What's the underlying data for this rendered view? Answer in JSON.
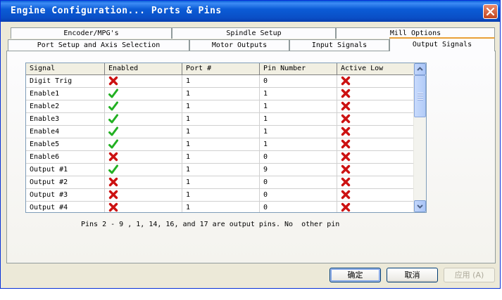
{
  "window": {
    "title": "Engine Configuration... Ports & Pins"
  },
  "tabs_back": [
    "Encoder/MPG's",
    "Spindle Setup",
    "Mill Options"
  ],
  "tabs_front": [
    "Port Setup and Axis Selection",
    "Motor Outputs",
    "Input Signals",
    "Output Signals"
  ],
  "active_tab": "Output Signals",
  "grid": {
    "columns": [
      "Signal",
      "Enabled",
      "Port #",
      "Pin Number",
      "Active Low"
    ],
    "rows": [
      {
        "signal": "Digit  Trig",
        "enabled": false,
        "port": "1",
        "pin": "0",
        "active_low": false
      },
      {
        "signal": "Enable1",
        "enabled": true,
        "port": "1",
        "pin": "1",
        "active_low": false
      },
      {
        "signal": "Enable2",
        "enabled": true,
        "port": "1",
        "pin": "1",
        "active_low": false
      },
      {
        "signal": "Enable3",
        "enabled": true,
        "port": "1",
        "pin": "1",
        "active_low": false
      },
      {
        "signal": "Enable4",
        "enabled": true,
        "port": "1",
        "pin": "1",
        "active_low": false
      },
      {
        "signal": "Enable5",
        "enabled": true,
        "port": "1",
        "pin": "1",
        "active_low": false
      },
      {
        "signal": "Enable6",
        "enabled": false,
        "port": "1",
        "pin": "0",
        "active_low": false
      },
      {
        "signal": "Output #1",
        "enabled": true,
        "port": "1",
        "pin": "9",
        "active_low": false
      },
      {
        "signal": "Output #2",
        "enabled": false,
        "port": "1",
        "pin": "0",
        "active_low": false
      },
      {
        "signal": "Output #3",
        "enabled": false,
        "port": "1",
        "pin": "0",
        "active_low": false
      },
      {
        "signal": "Output #4",
        "enabled": false,
        "port": "1",
        "pin": "0",
        "active_low": false
      }
    ]
  },
  "note": "Pins 2 - 9 , 1, 14, 16, and 17 are output pins. No  other pin",
  "buttons": {
    "ok": "确定",
    "cancel": "取消",
    "apply": "应用 (A)"
  },
  "icons": {
    "check": "green-check-icon",
    "cross": "red-x-icon"
  },
  "colors": {
    "title_bar": "#0a5fd8",
    "check": "#22b022",
    "cross": "#cc1111",
    "dialog_bg": "#ece9d8"
  }
}
